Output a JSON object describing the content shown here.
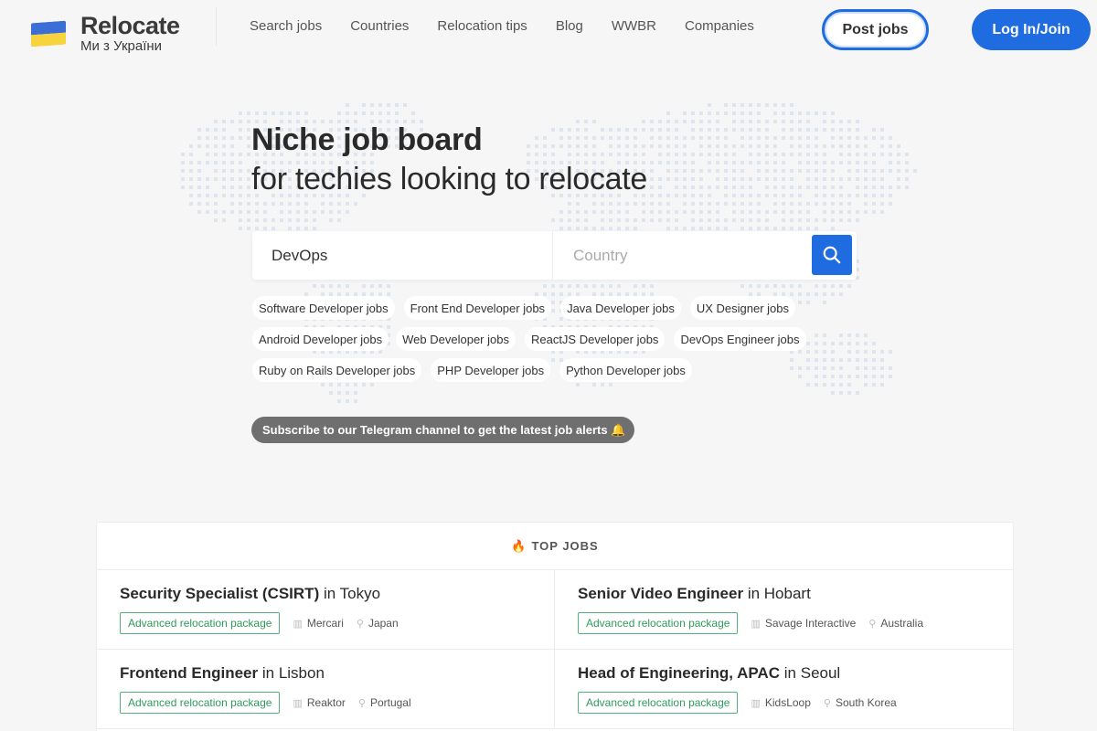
{
  "header": {
    "logo_title": "Relocate",
    "logo_subtitle": "Ми з України",
    "nav": [
      "Search jobs",
      "Countries",
      "Relocation tips",
      "Blog",
      "WWBR",
      "Companies"
    ],
    "post_jobs": "Post jobs",
    "login": "Log In/Join"
  },
  "hero": {
    "title_line1": "Niche job board",
    "title_line2": "for techies looking to relocate"
  },
  "search": {
    "keyword_value": "DevOps",
    "country_placeholder": "Country",
    "search_icon": "search-icon"
  },
  "tags": [
    [
      "Software Developer jobs",
      "Front End Developer jobs",
      "Java Developer jobs",
      "UX Designer jobs"
    ],
    [
      "Android Developer jobs",
      "Web Developer jobs",
      "ReactJS Developer jobs",
      "DevOps Engineer jobs"
    ],
    [
      "Ruby on Rails Developer jobs",
      "PHP Developer jobs",
      "Python Developer jobs"
    ]
  ],
  "telegram": "Subscribe to our Telegram channel to get the latest job alerts 🔔",
  "top_jobs": {
    "heading": "TOP JOBS",
    "jobs": [
      {
        "title": "Security Specialist (CSIRT)",
        "in": "in",
        "city": "Tokyo",
        "badge": "Advanced relocation package",
        "company": "Mercari",
        "country": "Japan"
      },
      {
        "title": "Senior Video Engineer",
        "in": "in",
        "city": "Hobart",
        "badge": "Advanced relocation package",
        "company": "Savage Interactive",
        "country": "Australia"
      },
      {
        "title": "Frontend Engineer",
        "in": "in",
        "city": "Lisbon",
        "badge": "Advanced relocation package",
        "company": "Reaktor",
        "country": "Portugal"
      },
      {
        "title": "Head of Engineering, APAC",
        "in": "in",
        "city": "Seoul",
        "badge": "Advanced relocation package",
        "company": "KidsLoop",
        "country": "South Korea"
      }
    ]
  },
  "colors": {
    "accent": "#1f6be0",
    "flag_blue": "#3b6fd6",
    "flag_yellow": "#f7d33d",
    "badge_green": "#2f9a5d"
  }
}
